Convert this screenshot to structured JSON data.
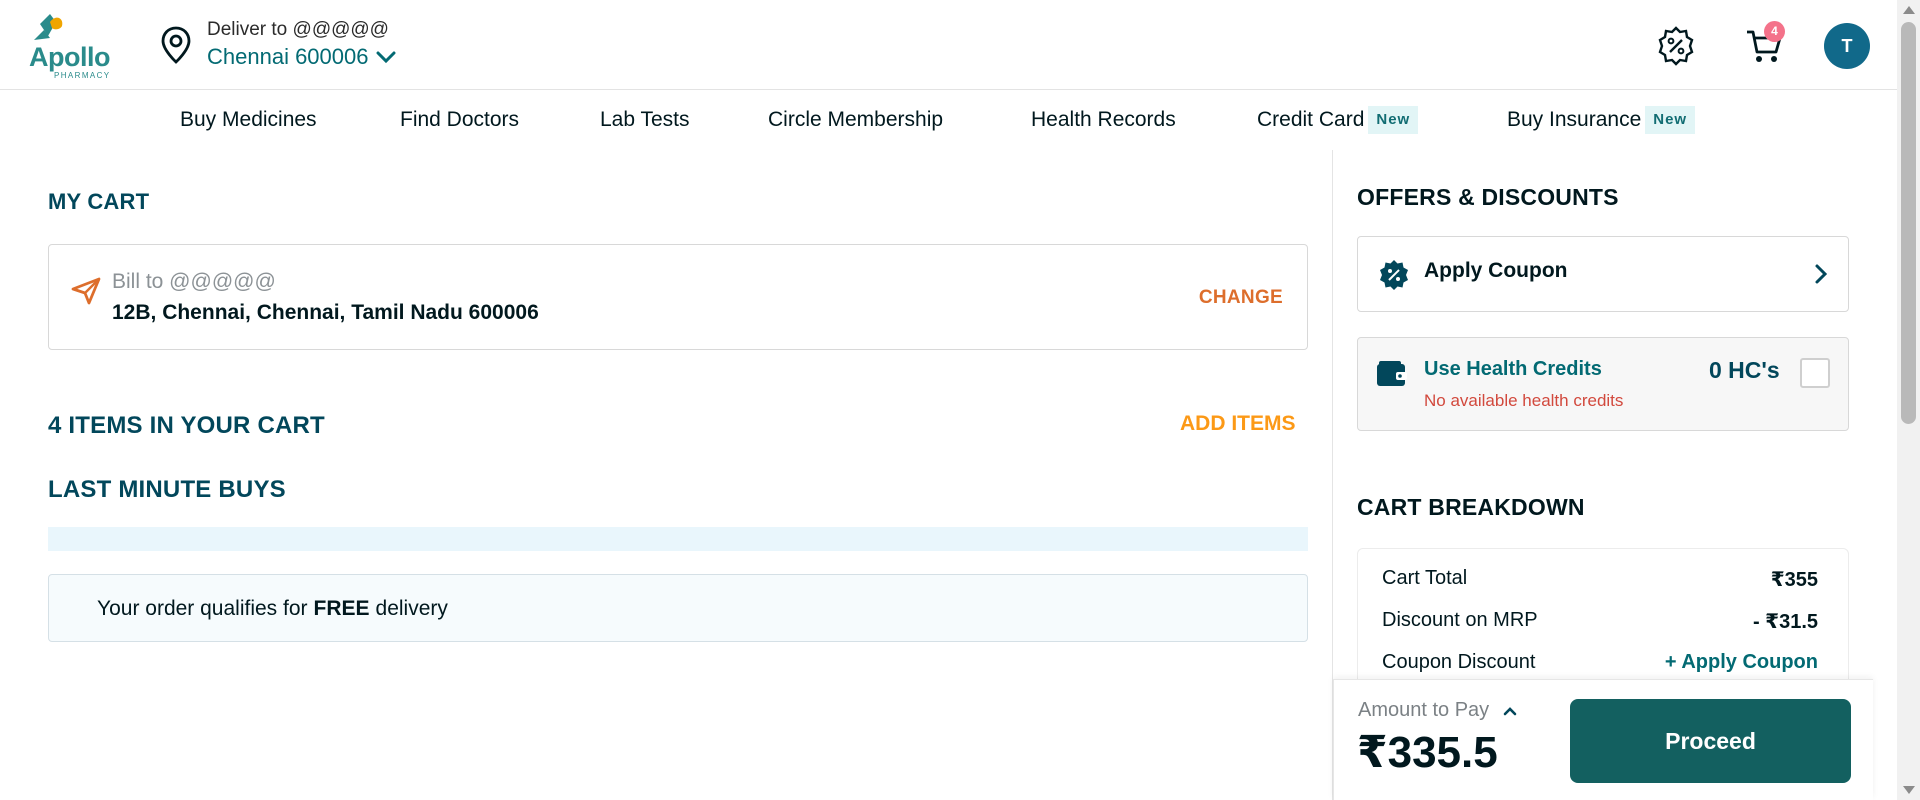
{
  "brand": {
    "name": "Apollo",
    "sub": "PHARMACY"
  },
  "location": {
    "deliver_label": "Deliver to @@@@@",
    "city": "Chennai 600006"
  },
  "header": {
    "cart_count": "4",
    "avatar_initial": "T"
  },
  "nav": [
    {
      "label": "Buy Medicines"
    },
    {
      "label": "Find Doctors"
    },
    {
      "label": "Lab Tests"
    },
    {
      "label": "Circle Membership"
    },
    {
      "label": "Health Records"
    },
    {
      "label": "Credit Card",
      "badge": "New"
    },
    {
      "label": "Buy Insurance",
      "badge": "New"
    }
  ],
  "cart": {
    "title": "MY CART",
    "bill_to": "Bill to @@@@@",
    "address": "12B, Chennai, Chennai, Tamil Nadu 600006",
    "change_label": "CHANGE",
    "items_title": "4 ITEMS IN YOUR CART",
    "add_items_label": "ADD ITEMS",
    "last_minute_title": "LAST MINUTE BUYS",
    "free_prefix": "Your order qualifies for",
    "free_bold": "FREE",
    "free_suffix": "delivery"
  },
  "offers": {
    "title": "OFFERS & DISCOUNTS",
    "apply_coupon": "Apply Coupon",
    "health_credits_title": "Use Health Credits",
    "health_credits_sub": "No available health credits",
    "health_credits_count": "0 HC's"
  },
  "breakdown": {
    "title": "CART BREAKDOWN",
    "rows": [
      {
        "label": "Cart Total",
        "value": "₹355"
      },
      {
        "label": "Discount on MRP",
        "value": "- ₹31.5"
      },
      {
        "label": "Coupon Discount",
        "value": "+ Apply Coupon"
      }
    ]
  },
  "pay": {
    "amount_label": "Amount to Pay",
    "amount": "₹335.5",
    "proceed_label": "Proceed"
  },
  "colors": {
    "primary": "#02475b",
    "teal": "#136060",
    "orange": "#fc9916",
    "change": "#dd6e2c",
    "error": "#d2493d"
  }
}
